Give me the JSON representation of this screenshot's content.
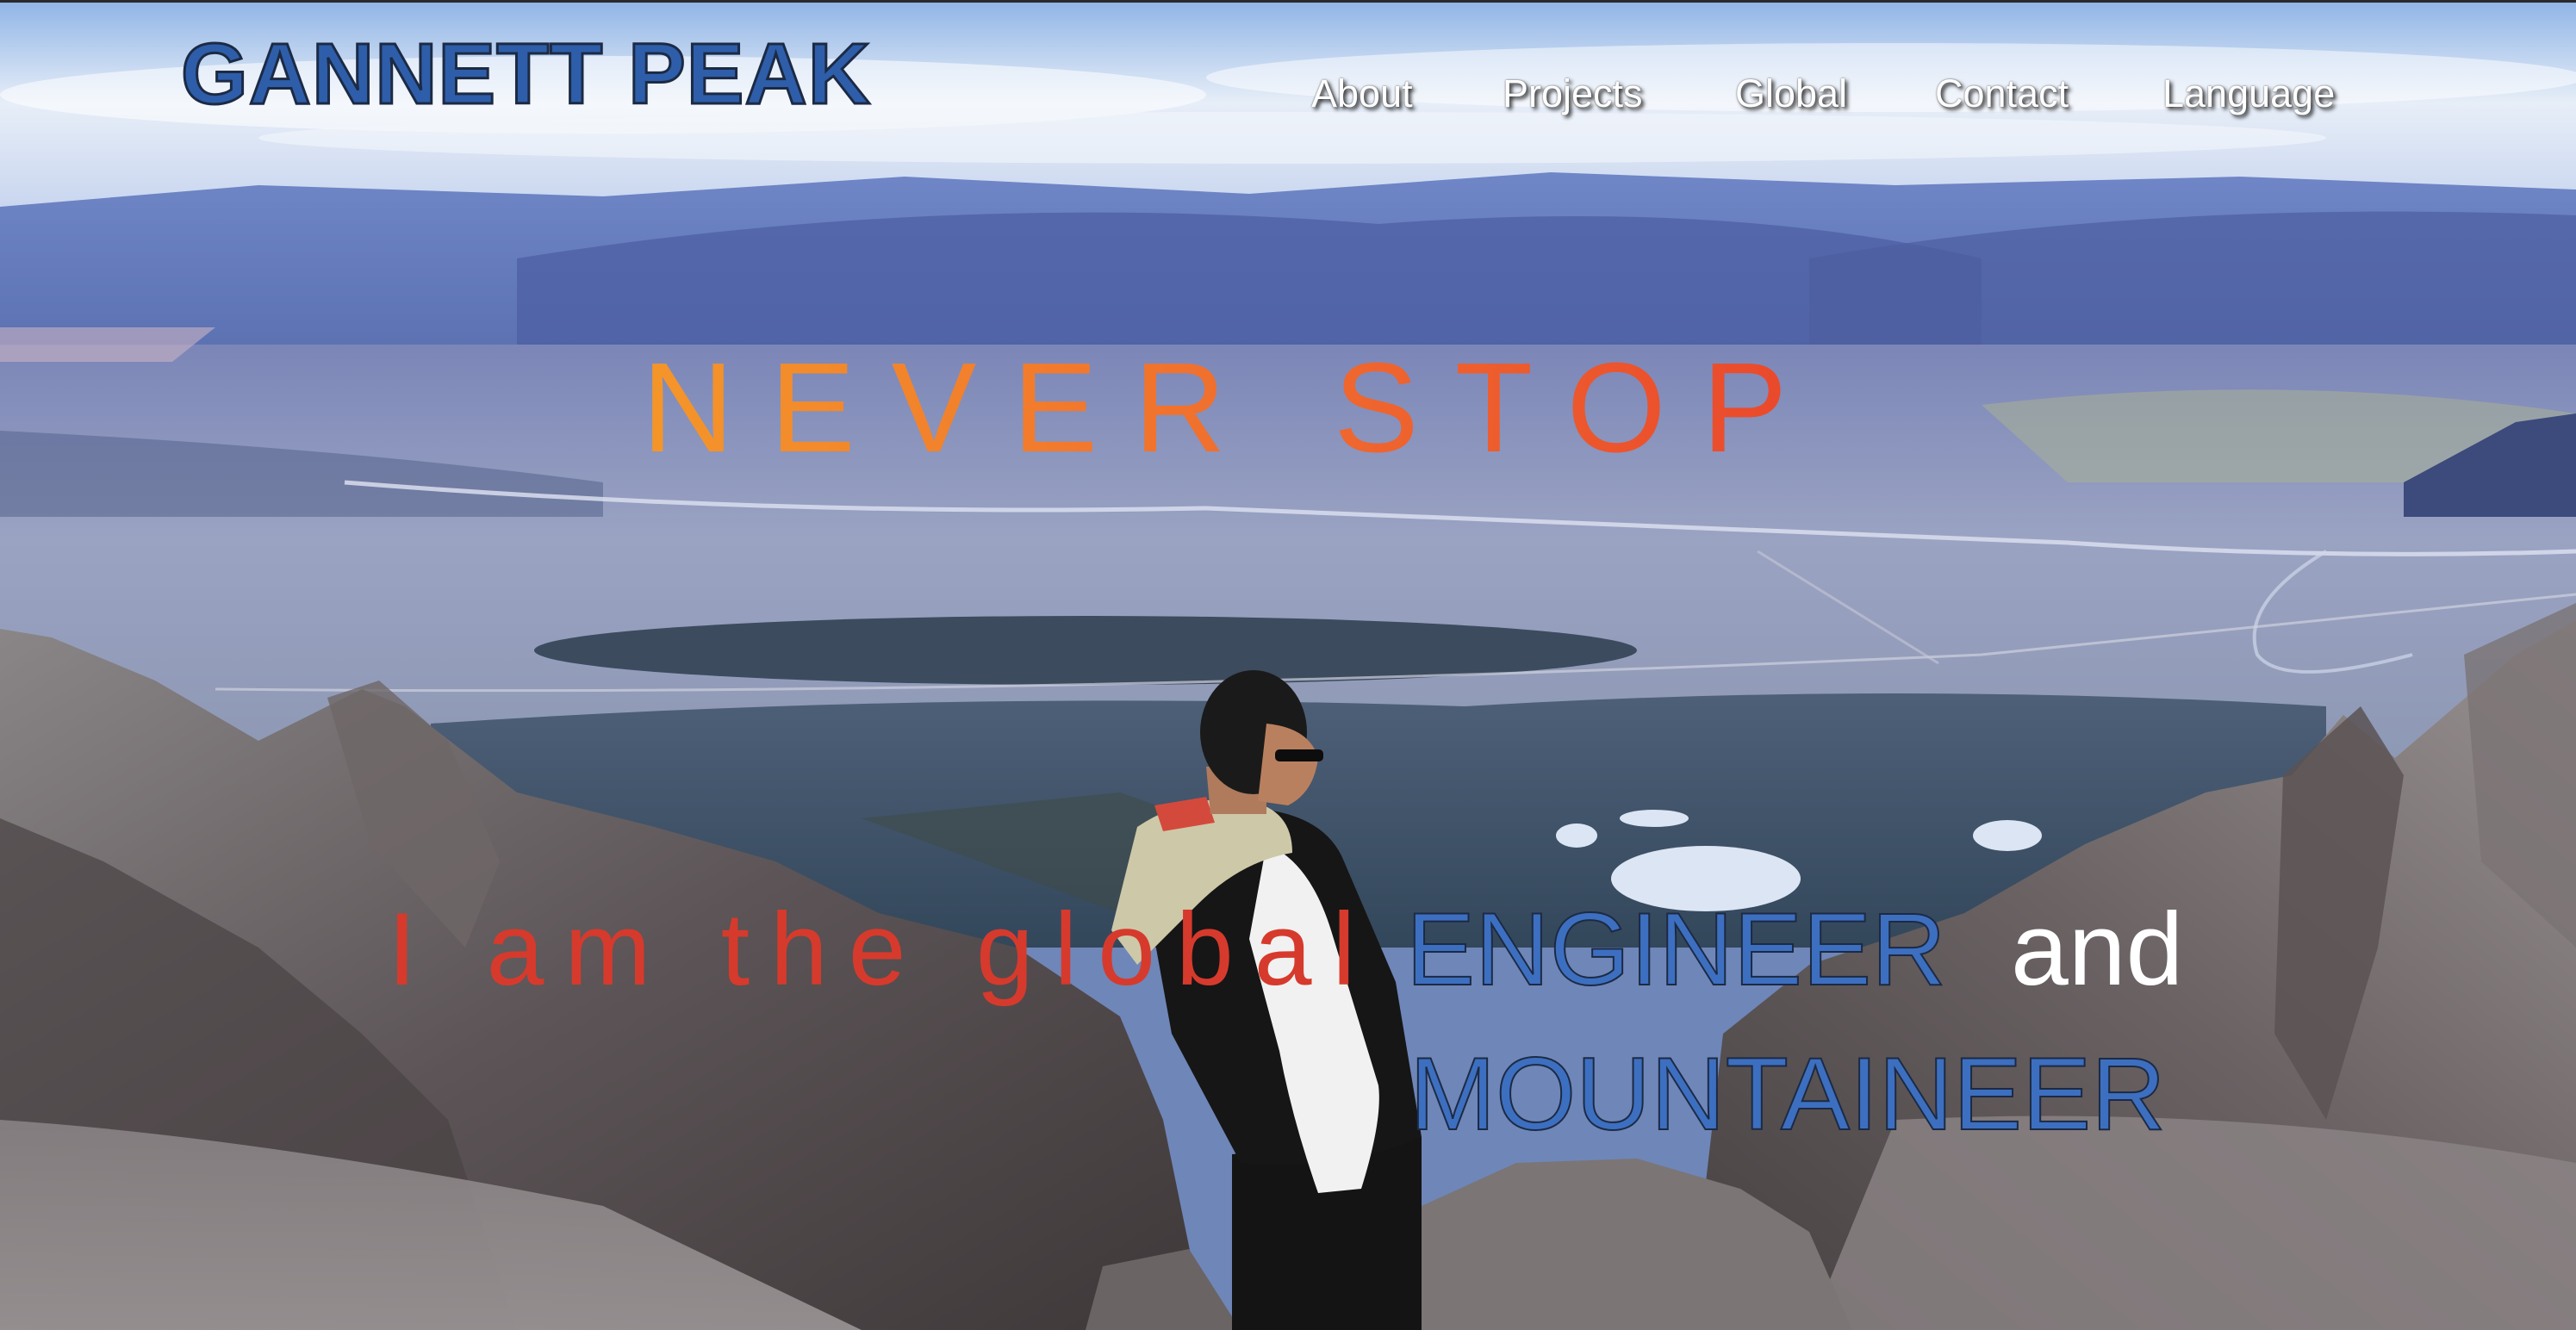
{
  "header": {
    "brand": "GANNETT PEAK",
    "nav": [
      {
        "label": "About"
      },
      {
        "label": "Projects"
      },
      {
        "label": "Global"
      },
      {
        "label": "Contact"
      },
      {
        "label": "Language"
      }
    ]
  },
  "hero": {
    "tagline": "NEVER STOP",
    "intro": "I am the global",
    "role_primary": "ENGINEER",
    "conjunction": "and",
    "role_secondary": "MOUNTAINEER"
  },
  "colors": {
    "brand": "#2e5eaa",
    "role": "#3d6fc0",
    "intro": "#d63a2c",
    "tagline_start": "#f4962a",
    "tagline_end": "#e9472c",
    "nav_text": "#ffffff"
  }
}
